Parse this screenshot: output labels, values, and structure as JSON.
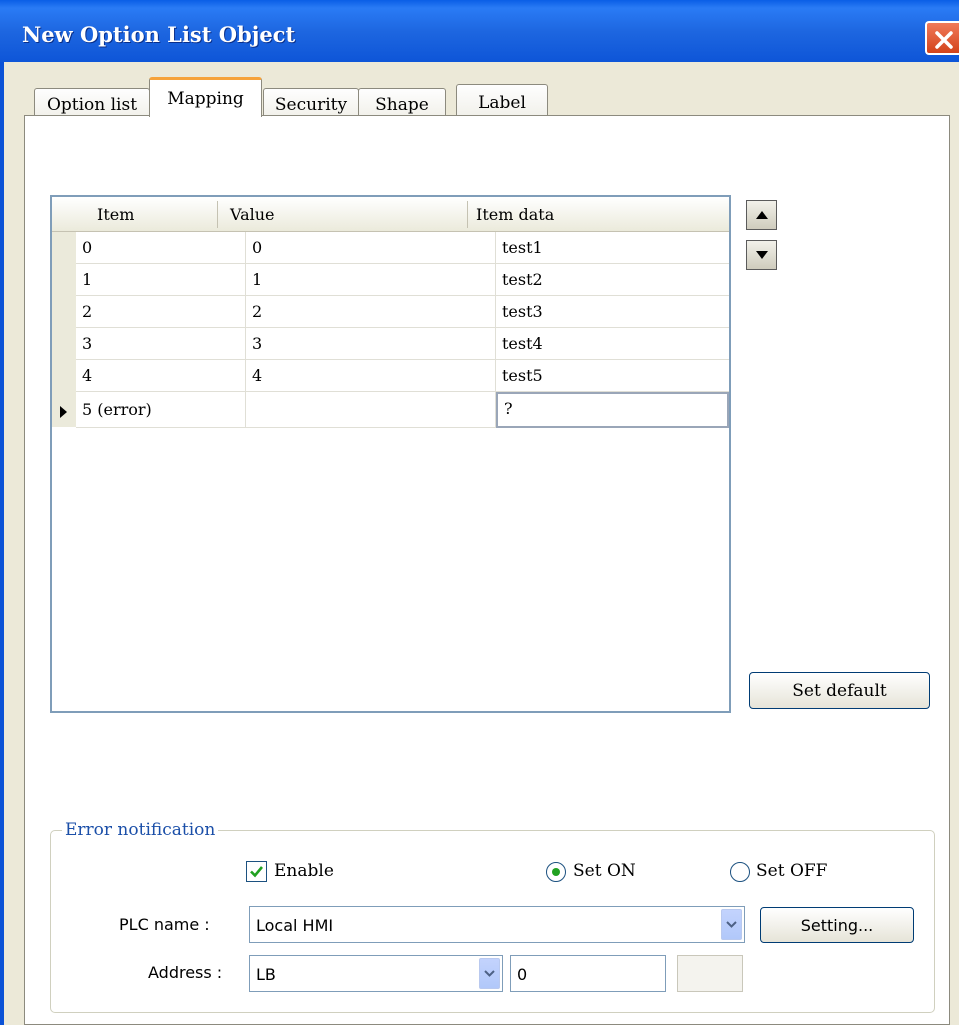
{
  "window": {
    "title": "New  Option List Object",
    "close_icon": "close-icon"
  },
  "tabs": [
    {
      "label": "Option list"
    },
    {
      "label": "Mapping",
      "active": true
    },
    {
      "label": "Security"
    },
    {
      "label": "Shape"
    },
    {
      "label": "Label"
    }
  ],
  "grid": {
    "columns": [
      "Item",
      "Value",
      "Item data"
    ],
    "rows": [
      {
        "item": "0",
        "value": "0",
        "item_data": "test1"
      },
      {
        "item": "1",
        "value": "1",
        "item_data": "test2"
      },
      {
        "item": "2",
        "value": "2",
        "item_data": "test3"
      },
      {
        "item": "3",
        "value": "3",
        "item_data": "test4"
      },
      {
        "item": "4",
        "value": "4",
        "item_data": "test5"
      },
      {
        "item": "5 (error)",
        "value": "",
        "item_data": "?"
      }
    ]
  },
  "buttons": {
    "move_up_icon": "arrow-up-icon",
    "move_down_icon": "arrow-down-icon",
    "set_default": "Set default"
  },
  "error_notification": {
    "title": "Error notification",
    "enable_label": "Enable",
    "enable_checked": true,
    "set_on_label": "Set ON",
    "set_off_label": "Set OFF",
    "selected": "Set ON",
    "plc_name_label": "PLC name :",
    "plc_name_value": "Local HMI",
    "setting_button": "Setting...",
    "address_label": "Address :",
    "address_device": "LB",
    "address_value": "0"
  }
}
